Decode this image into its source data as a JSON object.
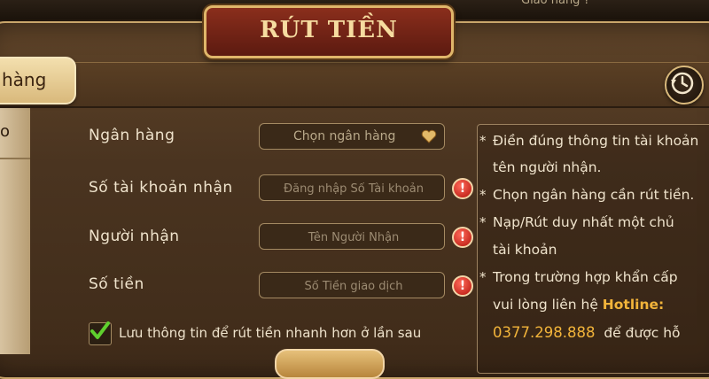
{
  "top_hint": "Giao hàng ?",
  "title": "RÚT TIỀN",
  "side_tab": {
    "label": "hàng"
  },
  "side_left": {
    "label": "o"
  },
  "form": {
    "bank": {
      "label": "Ngân hàng",
      "placeholder": "Chọn ngân hàng"
    },
    "account": {
      "label": "Số tài khoản nhận",
      "placeholder": "Đăng nhập Số Tài khoản"
    },
    "receiver": {
      "label": "Người nhận",
      "placeholder": "Tên Người Nhận"
    },
    "amount": {
      "label": "Số tiền",
      "placeholder": "Số Tiền giao dịch"
    },
    "alert_symbol": "!",
    "remember": {
      "label": "Lưu thông tin để rút tiền nhanh hơn ở lần sau",
      "checked": true
    }
  },
  "notes": {
    "star": "*",
    "line1a": "Điền đúng thông tin tài khoản",
    "line1b": "tên người nhận.",
    "line2": "Chọn ngân hàng cần rút tiền.",
    "line3a": "Nạp/Rút duy nhất một chủ",
    "line3b": "tài khoản",
    "line4a": "Trong trường hợp khẩn cấp",
    "line4b_prefix": "vui lòng liên hệ ",
    "line4b_hotline": "Hotline:",
    "phone": "0377.298.888",
    "line5_suffix": "để được hỗ"
  },
  "colors": {
    "accent": "#f2b43a",
    "panel": "#4a3420",
    "border": "#c9a66b",
    "alert": "#d9261a"
  },
  "icons": {
    "history": "history-icon",
    "heart": "heart-icon",
    "check": "checkmark-icon"
  }
}
